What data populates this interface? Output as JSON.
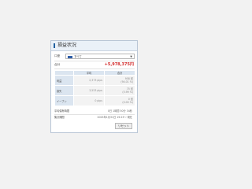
{
  "panel": {
    "title": "損益状況"
  },
  "account": {
    "label": "口座",
    "selected": "すべて"
  },
  "total": {
    "label": "合計",
    "value": "+5,978,375円"
  },
  "table": {
    "headers": [
      "",
      "平均",
      "合計"
    ],
    "rows": [
      {
        "label": "利益",
        "avg": "2,373 pips",
        "total_amount": "958 回",
        "total_sub": "(94.01 %)"
      },
      {
        "label": "損失",
        "avg": "3,553 pips",
        "total_amount": "75 回",
        "total_sub": "(5.99 %)"
      },
      {
        "label": "イーブン",
        "avg": "0 pips",
        "total_amount": "0 回",
        "total_sub": "(0.00 %)"
      }
    ]
  },
  "meta": {
    "holding_label": "平均保有時間",
    "holding_value": "0日 1時間 50分 34秒",
    "period_label": "集計期間",
    "period_value": "2025年1月31日 19:23〜 現在"
  },
  "buttons": {
    "reset_label": "リセット"
  },
  "colors": {
    "header_accent": "#1f5f9f",
    "profit_red": "#d22b2b"
  }
}
